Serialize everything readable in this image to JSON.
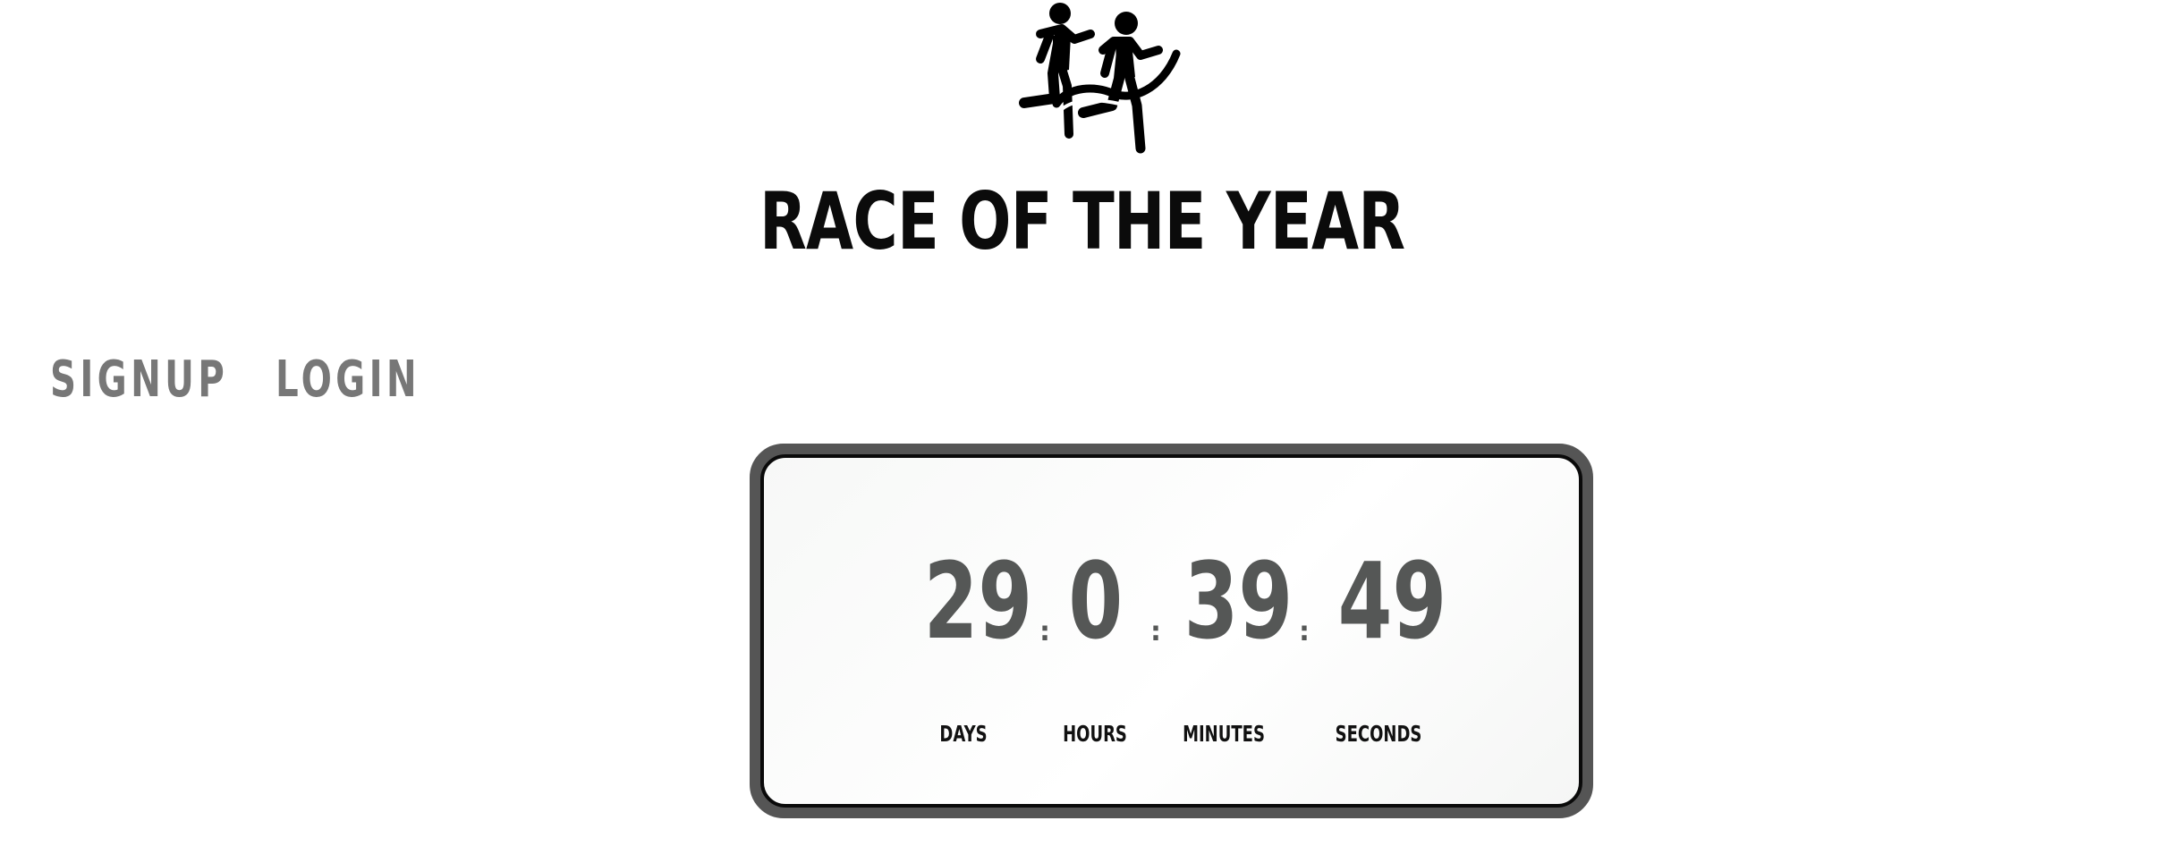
{
  "header": {
    "logo_icon": "runners-finish-line-icon",
    "title": "RACE OF THE YEAR"
  },
  "nav": {
    "signup_label": "SIGNUP",
    "login_label": "LOGIN"
  },
  "countdown": {
    "days": "29",
    "hours": "0",
    "minutes": "39",
    "seconds": "49",
    "separator": ":",
    "labels": {
      "days": "DAYS",
      "hours": "HOURS",
      "minutes": "MINUTES",
      "seconds": "SECONDS"
    }
  },
  "colors": {
    "timer_border": "#555555",
    "digits": "#555756",
    "nav_text": "#777777",
    "title_text": "#0b0b0b"
  }
}
